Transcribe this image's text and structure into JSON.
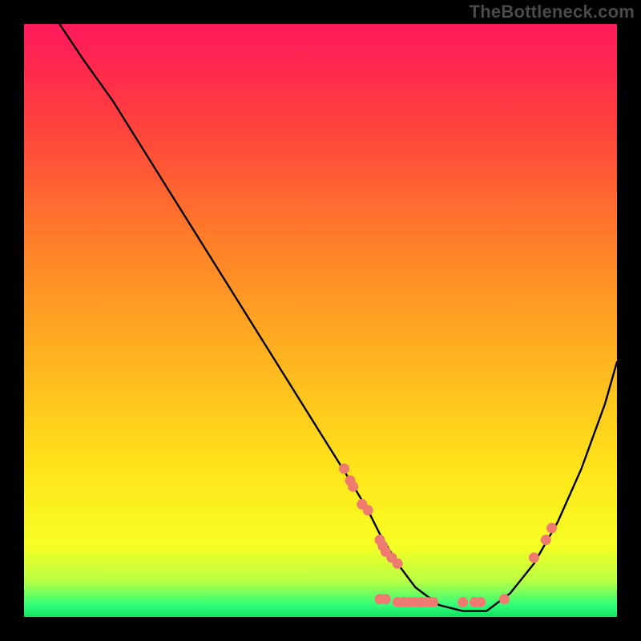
{
  "watermark": "TheBottleneck.com",
  "chart_data": {
    "type": "line",
    "title": "",
    "xlabel": "",
    "ylabel": "",
    "xlim": [
      0,
      100
    ],
    "ylim": [
      0,
      100
    ],
    "series": [
      {
        "name": "bottleneck-curve",
        "x": [
          6,
          10,
          15,
          20,
          25,
          30,
          35,
          40,
          45,
          50,
          55,
          58,
          60,
          63,
          66,
          70,
          74,
          78,
          82,
          86,
          90,
          94,
          98,
          100
        ],
        "values": [
          100,
          94,
          87,
          79,
          71,
          63,
          55,
          47,
          39,
          31,
          23,
          18,
          14,
          9,
          5,
          2,
          1,
          1,
          4,
          9,
          16,
          25,
          36,
          43
        ]
      }
    ],
    "markers": [
      {
        "name": "marker-left-upper-1",
        "x": 54,
        "y": 25
      },
      {
        "name": "marker-left-upper-2",
        "x": 55,
        "y": 23
      },
      {
        "name": "marker-left-upper-3",
        "x": 55.5,
        "y": 22
      },
      {
        "name": "marker-left-mid-1",
        "x": 57,
        "y": 19
      },
      {
        "name": "marker-left-mid-2",
        "x": 58,
        "y": 18
      },
      {
        "name": "marker-left-low-1",
        "x": 60,
        "y": 13
      },
      {
        "name": "marker-left-low-2",
        "x": 60.5,
        "y": 12
      },
      {
        "name": "marker-left-low-3",
        "x": 61,
        "y": 11
      },
      {
        "name": "marker-left-low-4",
        "x": 62,
        "y": 10
      },
      {
        "name": "marker-low-5",
        "x": 63,
        "y": 9
      },
      {
        "name": "marker-valley-1",
        "x": 60,
        "y": 3
      },
      {
        "name": "marker-valley-2",
        "x": 61,
        "y": 3
      },
      {
        "name": "marker-valley-3",
        "x": 63,
        "y": 2.5
      },
      {
        "name": "marker-valley-4",
        "x": 64,
        "y": 2.5
      },
      {
        "name": "marker-valley-5",
        "x": 65,
        "y": 2.5
      },
      {
        "name": "marker-valley-6",
        "x": 66,
        "y": 2.5
      },
      {
        "name": "marker-valley-7",
        "x": 67,
        "y": 2.5
      },
      {
        "name": "marker-valley-8",
        "x": 68,
        "y": 2.5
      },
      {
        "name": "marker-valley-9",
        "x": 69,
        "y": 2.5
      },
      {
        "name": "marker-valley-10",
        "x": 74,
        "y": 2.5
      },
      {
        "name": "marker-valley-11",
        "x": 76,
        "y": 2.5
      },
      {
        "name": "marker-valley-12",
        "x": 77,
        "y": 2.5
      },
      {
        "name": "marker-valley-13",
        "x": 81,
        "y": 3
      },
      {
        "name": "marker-right-up-1",
        "x": 86,
        "y": 10
      },
      {
        "name": "marker-right-up-2",
        "x": 88,
        "y": 13
      },
      {
        "name": "marker-right-up-3",
        "x": 89,
        "y": 15
      }
    ],
    "colors": {
      "curve": "#000000",
      "markers": "#ef7a6f",
      "gradient_top": "#ff1a5c",
      "gradient_bottom": "#10e060"
    }
  }
}
